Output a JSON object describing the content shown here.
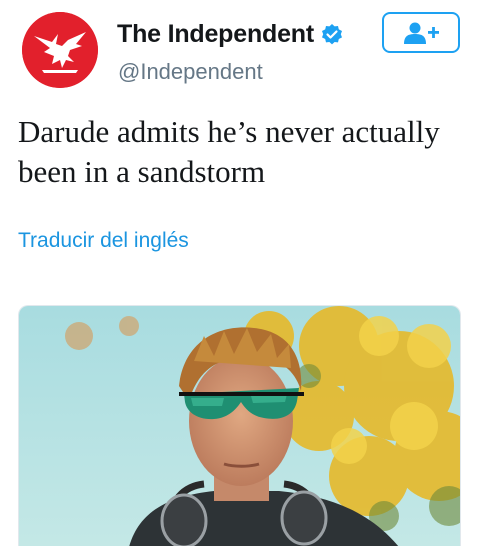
{
  "account": {
    "name": "The Independent",
    "handle": "@Independent",
    "avatar_icon": "eagle-logo-icon",
    "verified_icon": "verified-badge-icon",
    "brand_color": "#e2202c"
  },
  "follow_button": {
    "icon": "follow-user-plus-icon",
    "accent": "#1da1f2"
  },
  "tweet": {
    "text": "Darude admits he’s never actually been in a sandstorm"
  },
  "translate": {
    "label": "Traducir del inglés",
    "color": "#1b95e0"
  },
  "media": {
    "icon": "photo"
  }
}
